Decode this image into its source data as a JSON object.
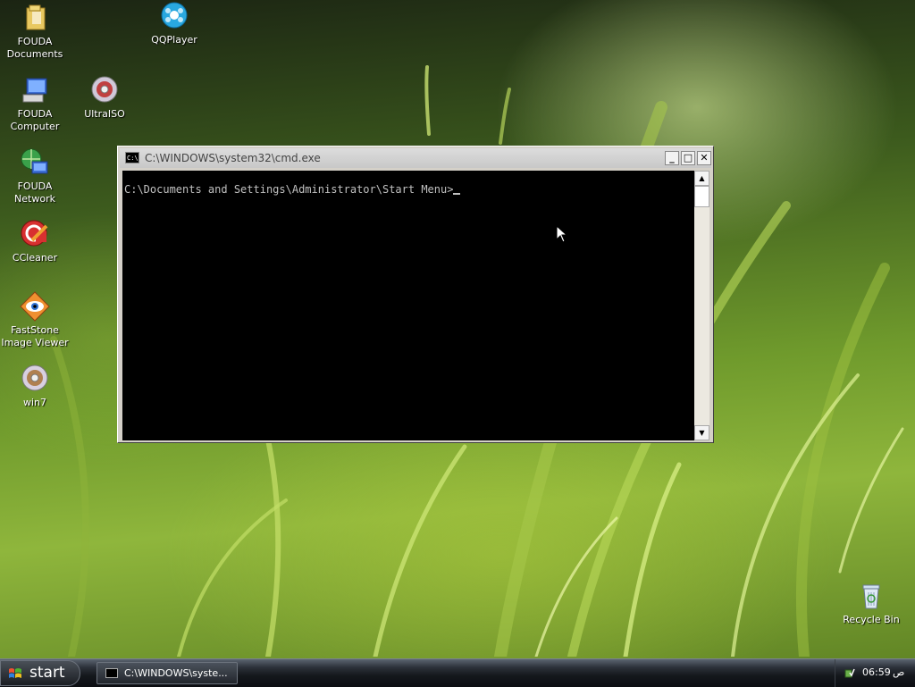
{
  "desktop": {
    "icons": [
      {
        "label": "FOUDA\nDocuments",
        "icon": "folder-icon"
      },
      {
        "label": "QQPlayer",
        "icon": "qqplayer-icon"
      },
      {
        "label": "FOUDA\nComputer",
        "icon": "computer-icon"
      },
      {
        "label": "UltraISO",
        "icon": "ultraiso-icon"
      },
      {
        "label": "FOUDA\nNetwork",
        "icon": "network-icon"
      },
      {
        "label": "CCleaner",
        "icon": "ccleaner-icon"
      },
      {
        "label": "FastStone\nImage Viewer",
        "icon": "faststone-icon"
      },
      {
        "label": "win7",
        "icon": "disc-icon"
      },
      {
        "label": "Recycle Bin",
        "icon": "recycle-bin-icon"
      }
    ]
  },
  "cmd_window": {
    "title": "C:\\WINDOWS\\system32\\cmd.exe",
    "prompt": "C:\\Documents and Settings\\Administrator\\Start Menu>",
    "minimize_label": "_",
    "maximize_label": "□",
    "close_label": "✕"
  },
  "taskbar": {
    "start_label": "start",
    "task_label": "C:\\WINDOWS\\syste...",
    "clock": "06:59",
    "ampm": "ص"
  }
}
